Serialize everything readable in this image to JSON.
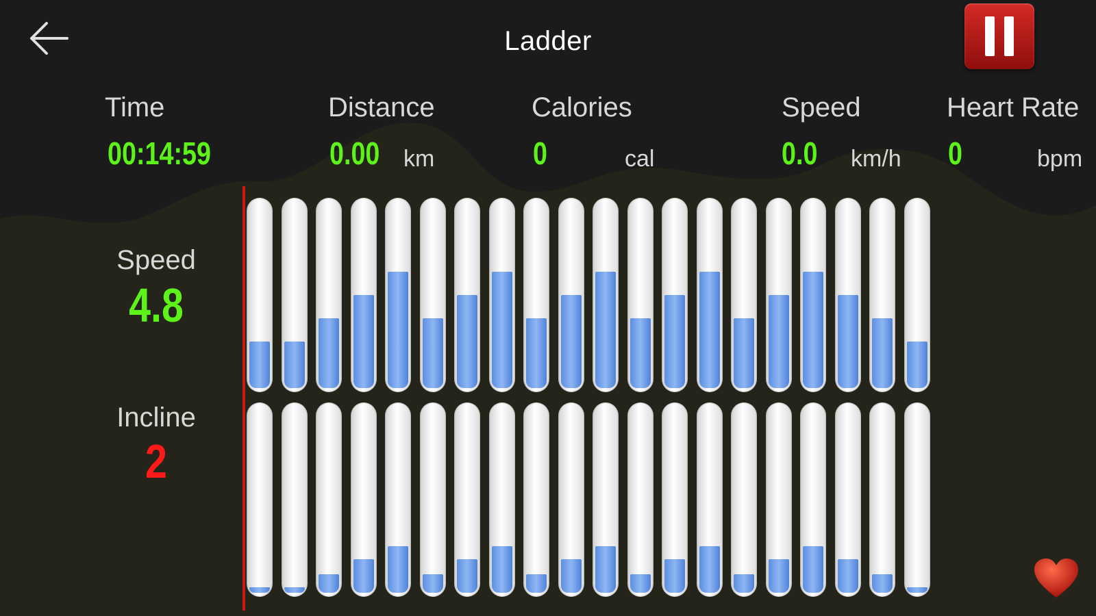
{
  "header": {
    "title": "Ladder",
    "back_icon": "arrow-left-icon",
    "pause_icon": "pause-icon",
    "pause_color": "#c0171a"
  },
  "stats": {
    "time": {
      "label": "Time",
      "value": "00:14:59",
      "unit": ""
    },
    "distance": {
      "label": "Distance",
      "value": "0.00",
      "unit": "km"
    },
    "calories": {
      "label": "Calories",
      "value": "0",
      "unit": "cal"
    },
    "speed": {
      "label": "Speed",
      "value": "0.0",
      "unit": "km/h"
    },
    "heart_rate": {
      "label": "Heart Rate",
      "value": "0",
      "unit": "bpm"
    }
  },
  "current": {
    "speed": {
      "label": "Speed",
      "value": "4.8",
      "color": "#5cf21a"
    },
    "incline": {
      "label": "Incline",
      "value": "2",
      "color": "#ff1a1a"
    }
  },
  "program": {
    "speed_levels": [
      0.25,
      0.25,
      0.375,
      0.5,
      0.625,
      0.375,
      0.5,
      0.625,
      0.375,
      0.5,
      0.625,
      0.375,
      0.5,
      0.625,
      0.375,
      0.5,
      0.625,
      0.5,
      0.375,
      0.25
    ],
    "incline_levels": [
      0.03,
      0.03,
      0.1,
      0.18,
      0.25,
      0.1,
      0.18,
      0.25,
      0.1,
      0.18,
      0.25,
      0.1,
      0.18,
      0.25,
      0.1,
      0.18,
      0.25,
      0.18,
      0.1,
      0.03
    ],
    "bar_fill_color": "#6b9df0",
    "current_segment_color": "#c81a12"
  },
  "footer": {
    "heart_icon": "heart-icon"
  }
}
